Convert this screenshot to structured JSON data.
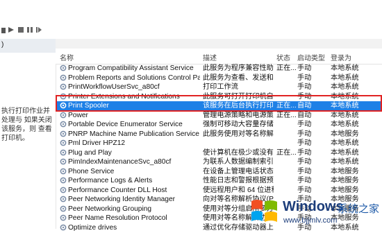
{
  "columns": {
    "name": "名称",
    "desc": "描述",
    "status": "状态",
    "startup": "启动类型",
    "logon": "登录为"
  },
  "left_pane": {
    "top_label": ")",
    "description": "执行打印作业并处理与 如果关闭该服务，则 查看打印机。"
  },
  "services": [
    {
      "name": "Program Compatibility Assistant Service",
      "desc": "此服务为程序兼容性助手(...",
      "status": "正在...",
      "startup": "手动",
      "logon": "本地系统"
    },
    {
      "name": "Problem Reports and Solutions Control Panel Su...",
      "desc": "此服务为查看、发送和删...",
      "status": "",
      "startup": "手动",
      "logon": "本地系统"
    },
    {
      "name": "PrintWorkflowUserSvc_a80cf",
      "desc": "打印工作流",
      "status": "",
      "startup": "手动",
      "logon": "本地系统"
    },
    {
      "name": "Printer Extensions and Notifications",
      "desc": "此服务可打开打印机自定...",
      "status": "",
      "startup": "手动",
      "logon": "本地系统"
    },
    {
      "name": "Print Spooler",
      "desc": "该服务在后台执行打印作...",
      "status": "正在...",
      "startup": "自动",
      "logon": "本地系统",
      "selected": true
    },
    {
      "name": "Power",
      "desc": "管理电源策略和电源策略...",
      "status": "正在...",
      "startup": "自动",
      "logon": "本地系统"
    },
    {
      "name": "Portable Device Enumerator Service",
      "desc": "强制可移动大容量存储设...",
      "status": "",
      "startup": "手动",
      "logon": "本地系统"
    },
    {
      "name": "PNRP Machine Name Publication Service",
      "desc": "此服务使用对等名称解析...",
      "status": "",
      "startup": "手动",
      "logon": "本地服务"
    },
    {
      "name": "Pml Driver HPZ12",
      "desc": "",
      "status": "",
      "startup": "手动",
      "logon": "本地系统"
    },
    {
      "name": "Plug and Play",
      "desc": "使计算机在极少或没有用...",
      "status": "正在...",
      "startup": "手动",
      "logon": "本地系统"
    },
    {
      "name": "PimIndexMaintenanceSvc_a80cf",
      "desc": "为联系人数据编制索引以...",
      "status": "",
      "startup": "手动",
      "logon": "本地系统"
    },
    {
      "name": "Phone Service",
      "desc": "在设备上管理电话状态",
      "status": "",
      "startup": "手动",
      "logon": "本地服务"
    },
    {
      "name": "Performance Logs & Alerts",
      "desc": "性能日志和警报根据预配...",
      "status": "",
      "startup": "手动",
      "logon": "本地服务"
    },
    {
      "name": "Performance Counter DLL Host",
      "desc": "使远程用户和 64 位进程...",
      "status": "",
      "startup": "手动",
      "logon": "本地服务"
    },
    {
      "name": "Peer Networking Identity Manager",
      "desc": "向对等名称解析协议(PNR...",
      "status": "",
      "startup": "手动",
      "logon": "本地服务"
    },
    {
      "name": "Peer Networking Grouping",
      "desc": "使用对等分组启用多方通...",
      "status": "",
      "startup": "手动",
      "logon": "本地服务"
    },
    {
      "name": "Peer Name Resolution Protocol",
      "desc": "使用对等名称解析协议(P...",
      "status": "",
      "startup": "手动",
      "logon": "本地服务"
    },
    {
      "name": "Optimize drives",
      "desc": "通过优化存储驱动器上的...",
      "status": "",
      "startup": "手动",
      "logon": "本地系统"
    }
  ],
  "watermark": {
    "brand": "Windows",
    "suffix": "系统之家",
    "url": "www.bjjmlv.com"
  },
  "colors": {
    "selection": "#1e80e6",
    "highlight_box": "#e02222"
  }
}
